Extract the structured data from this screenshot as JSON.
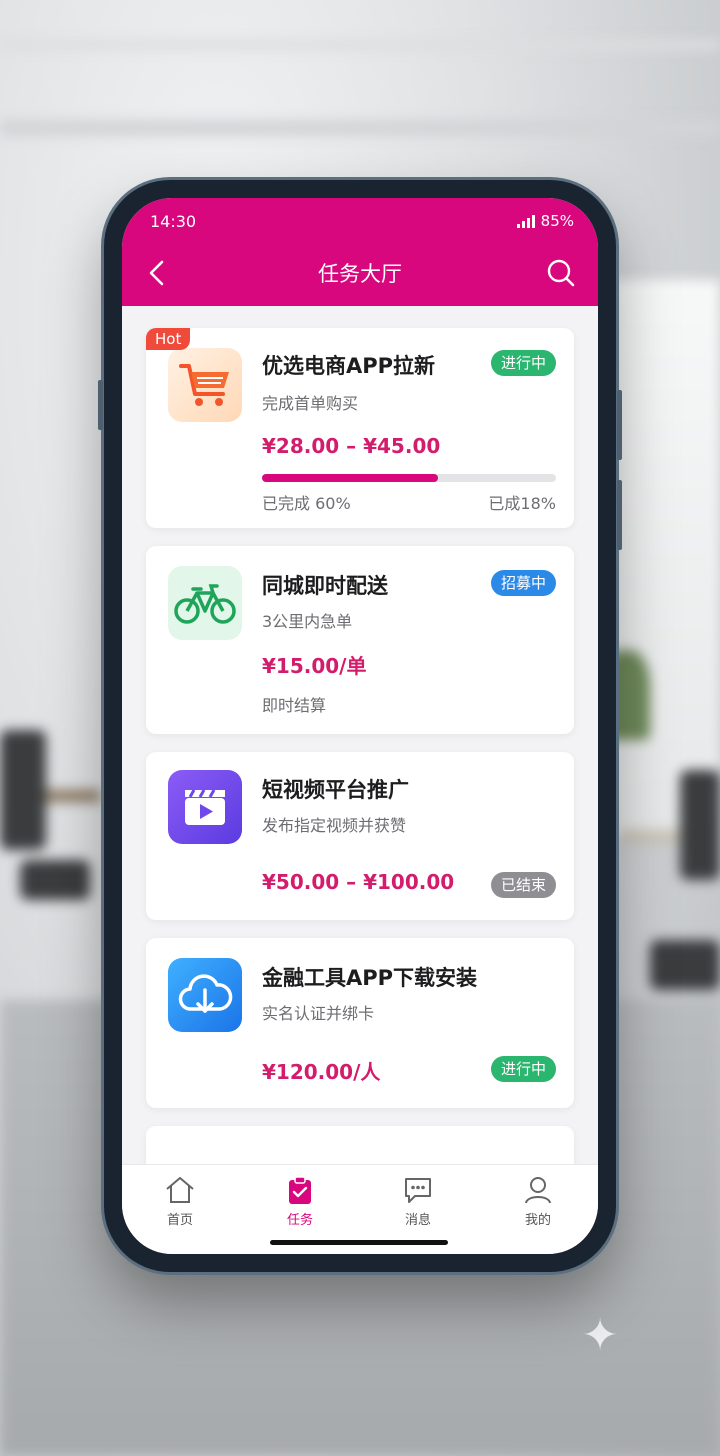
{
  "status_bar": {
    "time": "14:30",
    "battery": "85%"
  },
  "header": {
    "title": "任务大厅"
  },
  "tasks": [
    {
      "hot_label": "Hot",
      "title": "优选电商APP拉新",
      "subtitle": "完成首单购买",
      "price": "¥28.00 – ¥45.00",
      "status": "进行中",
      "status_color": "#2ab66e",
      "progress_percent": 60,
      "progress_left": "已完成 60%",
      "progress_right": "已成18%",
      "icon": "shopping-cart-icon"
    },
    {
      "title": "同城即时配送",
      "subtitle": "3公里内急单",
      "price": "¥15.00/单",
      "note": "即时结算",
      "status": "招募中",
      "status_color": "#2b8ae8",
      "icon": "bicycle-icon"
    },
    {
      "title": "短视频平台推广",
      "subtitle": "发布指定视频并获赞",
      "price": "¥50.00 – ¥100.00",
      "status": "已结束",
      "status_color": "#8e8e93",
      "icon": "video-clapper-icon"
    },
    {
      "title": "金融工具APP下载安装",
      "subtitle": "实名认证并绑卡",
      "price": "¥120.00/人",
      "status": "进行中",
      "status_color": "#2ab66e",
      "icon": "cloud-download-icon"
    }
  ],
  "tabbar": {
    "items": [
      {
        "label": "首页",
        "icon": "home-icon",
        "active": false
      },
      {
        "label": "任务",
        "icon": "clipboard-check-icon",
        "active": true
      },
      {
        "label": "消息",
        "icon": "chat-bubble-icon",
        "active": false
      },
      {
        "label": "我的",
        "icon": "user-icon",
        "active": false
      }
    ]
  },
  "colors": {
    "brand": "#d8077e",
    "price": "#d41c6d"
  }
}
